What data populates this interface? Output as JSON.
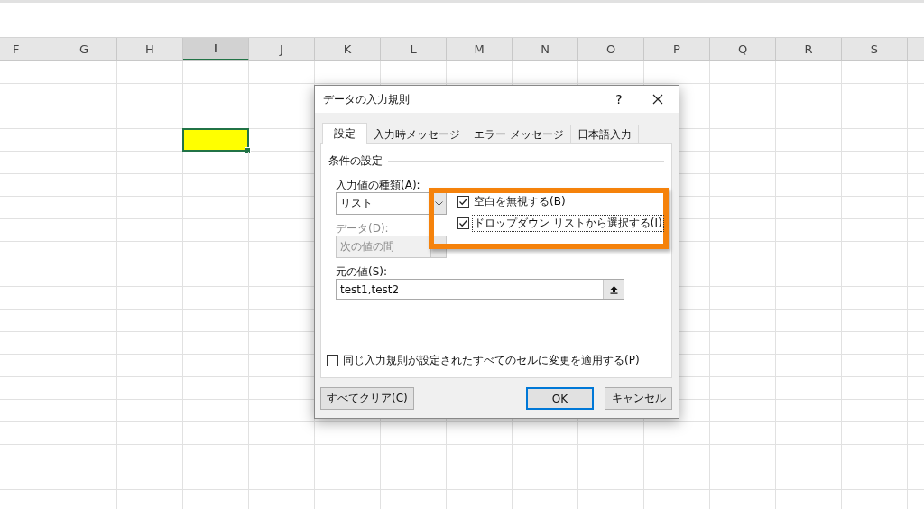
{
  "columns": [
    {
      "label": "F",
      "selected": false
    },
    {
      "label": "G",
      "selected": false
    },
    {
      "label": "H",
      "selected": false
    },
    {
      "label": "I",
      "selected": true
    },
    {
      "label": "J",
      "selected": false
    },
    {
      "label": "K",
      "selected": false
    },
    {
      "label": "L",
      "selected": false
    },
    {
      "label": "M",
      "selected": false
    },
    {
      "label": "N",
      "selected": false
    },
    {
      "label": "O",
      "selected": false
    },
    {
      "label": "P",
      "selected": false
    },
    {
      "label": "Q",
      "selected": false
    },
    {
      "label": "R",
      "selected": false
    },
    {
      "label": "S",
      "selected": false
    }
  ],
  "filled_cell": {
    "color": "#ffff00"
  },
  "dialog": {
    "title": "データの入力規則",
    "help_button": "?",
    "tabs": [
      {
        "label": "設定",
        "selected": true
      },
      {
        "label": "入力時メッセージ",
        "selected": false
      },
      {
        "label": "エラー メッセージ",
        "selected": false
      },
      {
        "label": "日本語入力",
        "selected": false
      }
    ],
    "section_title": "条件の設定",
    "allow_label": "入力値の種類(A):",
    "allow_dropdown": {
      "value": "リスト",
      "disabled": false
    },
    "checkboxes": [
      {
        "label": "空白を無視する(B)",
        "checked": true
      },
      {
        "label": "ドロップダウン リストから選択する(I)",
        "checked": true
      }
    ],
    "data_label": {
      "text": "データ(D):",
      "disabled": true
    },
    "data_dropdown": {
      "value": "次の値の間",
      "disabled": true
    },
    "source_label": "元の値(S):",
    "source_field": {
      "value": "test1,test2"
    },
    "apply_all": {
      "label": "同じ入力規則が設定されたすべてのセルに変更を適用する(P)",
      "checked": false
    },
    "clear_button": "すべてクリア(C)",
    "ok_button": "OK",
    "cancel_button": "キャンセル"
  }
}
